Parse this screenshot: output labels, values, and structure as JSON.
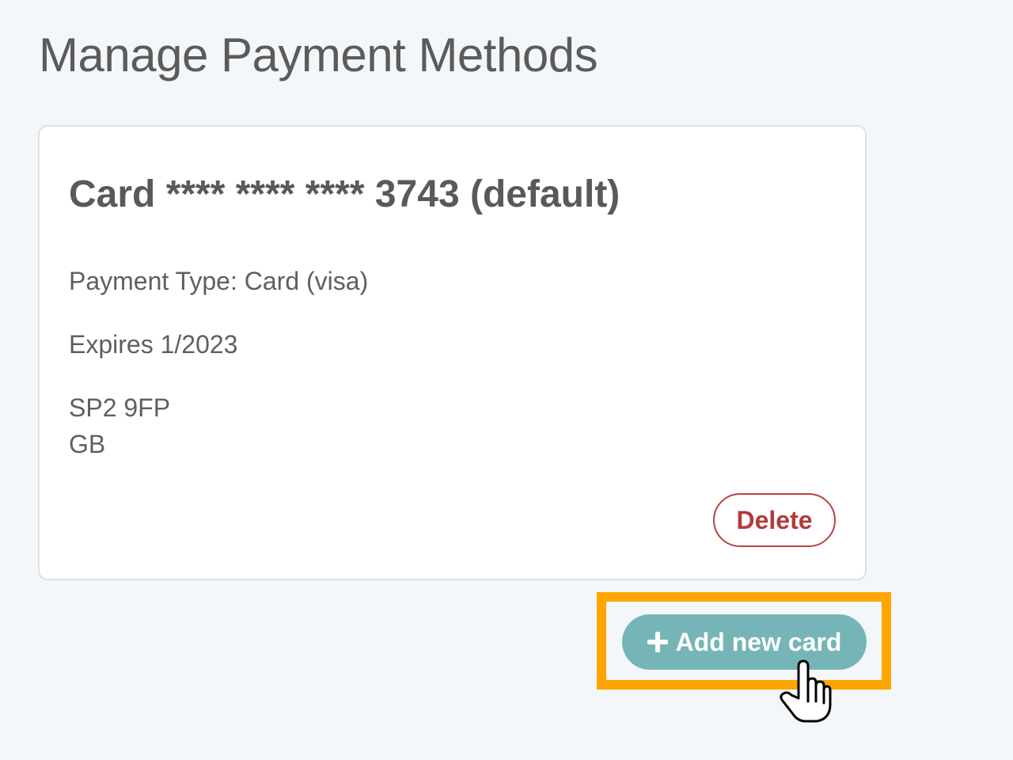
{
  "page": {
    "title": "Manage Payment Methods"
  },
  "payment_card": {
    "title": "Card **** **** **** 3743 (default)",
    "payment_type": "Payment Type: Card (visa)",
    "expires": "Expires 1/2023",
    "postcode": "SP2 9FP",
    "country": "GB",
    "delete_label": "Delete"
  },
  "actions": {
    "add_card_label": "Add new card",
    "add_card_icon": "plus-icon"
  },
  "colors": {
    "background": "#f4f7fa",
    "add_button": "#76b5b7",
    "delete_accent": "#b23b3b",
    "highlight": "#ffa500"
  },
  "cursor": {
    "icon": "hand-pointer-icon"
  }
}
